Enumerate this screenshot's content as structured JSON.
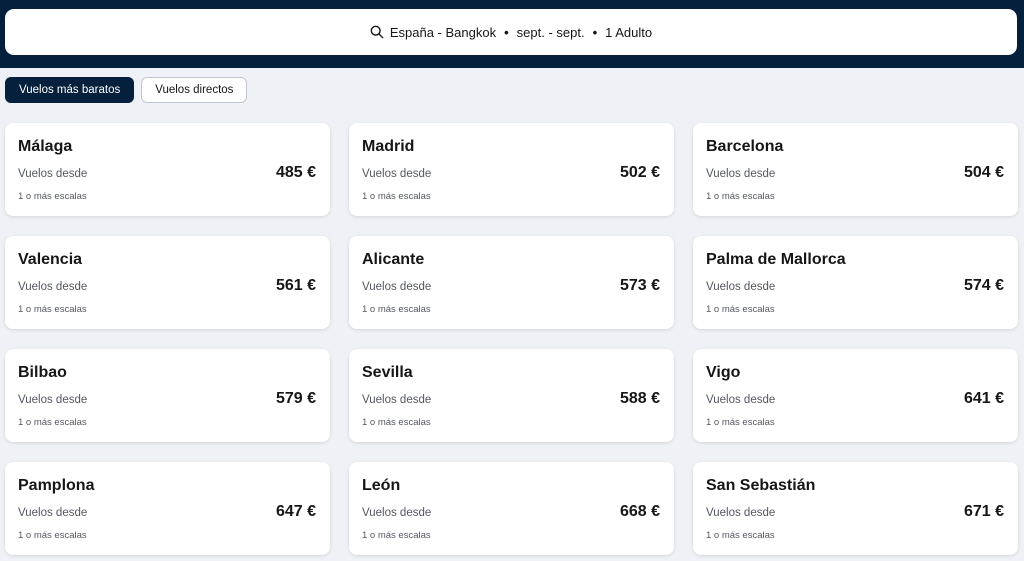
{
  "search": {
    "route": "España - Bangkok",
    "dates": "sept. - sept.",
    "passengers": "1 Adulto",
    "separator": "•"
  },
  "tabs": [
    {
      "label": "Vuelos más baratos",
      "active": true
    },
    {
      "label": "Vuelos directos",
      "active": false
    }
  ],
  "destinations": [
    {
      "city": "Málaga",
      "from_label": "Vuelos desde",
      "price": "485 €",
      "stops": "1 o más escalas"
    },
    {
      "city": "Madrid",
      "from_label": "Vuelos desde",
      "price": "502 €",
      "stops": "1 o más escalas"
    },
    {
      "city": "Barcelona",
      "from_label": "Vuelos desde",
      "price": "504 €",
      "stops": "1 o más escalas"
    },
    {
      "city": "Valencia",
      "from_label": "Vuelos desde",
      "price": "561 €",
      "stops": "1 o más escalas"
    },
    {
      "city": "Alicante",
      "from_label": "Vuelos desde",
      "price": "573 €",
      "stops": "1 o más escalas"
    },
    {
      "city": "Palma de Mallorca",
      "from_label": "Vuelos desde",
      "price": "574 €",
      "stops": "1 o más escalas"
    },
    {
      "city": "Bilbao",
      "from_label": "Vuelos desde",
      "price": "579 €",
      "stops": "1 o más escalas"
    },
    {
      "city": "Sevilla",
      "from_label": "Vuelos desde",
      "price": "588 €",
      "stops": "1 o más escalas"
    },
    {
      "city": "Vigo",
      "from_label": "Vuelos desde",
      "price": "641 €",
      "stops": "1 o más escalas"
    },
    {
      "city": "Pamplona",
      "from_label": "Vuelos desde",
      "price": "647 €",
      "stops": "1 o más escalas"
    },
    {
      "city": "León",
      "from_label": "Vuelos desde",
      "price": "668 €",
      "stops": "1 o más escalas"
    },
    {
      "city": "San Sebastián",
      "from_label": "Vuelos desde",
      "price": "671 €",
      "stops": "1 o más escalas"
    }
  ],
  "icons": {
    "search": "search-icon"
  },
  "colors": {
    "header_bg": "#05203c",
    "page_bg": "#eef1f6",
    "card_bg": "#ffffff",
    "active_tab_bg": "#05203c"
  }
}
